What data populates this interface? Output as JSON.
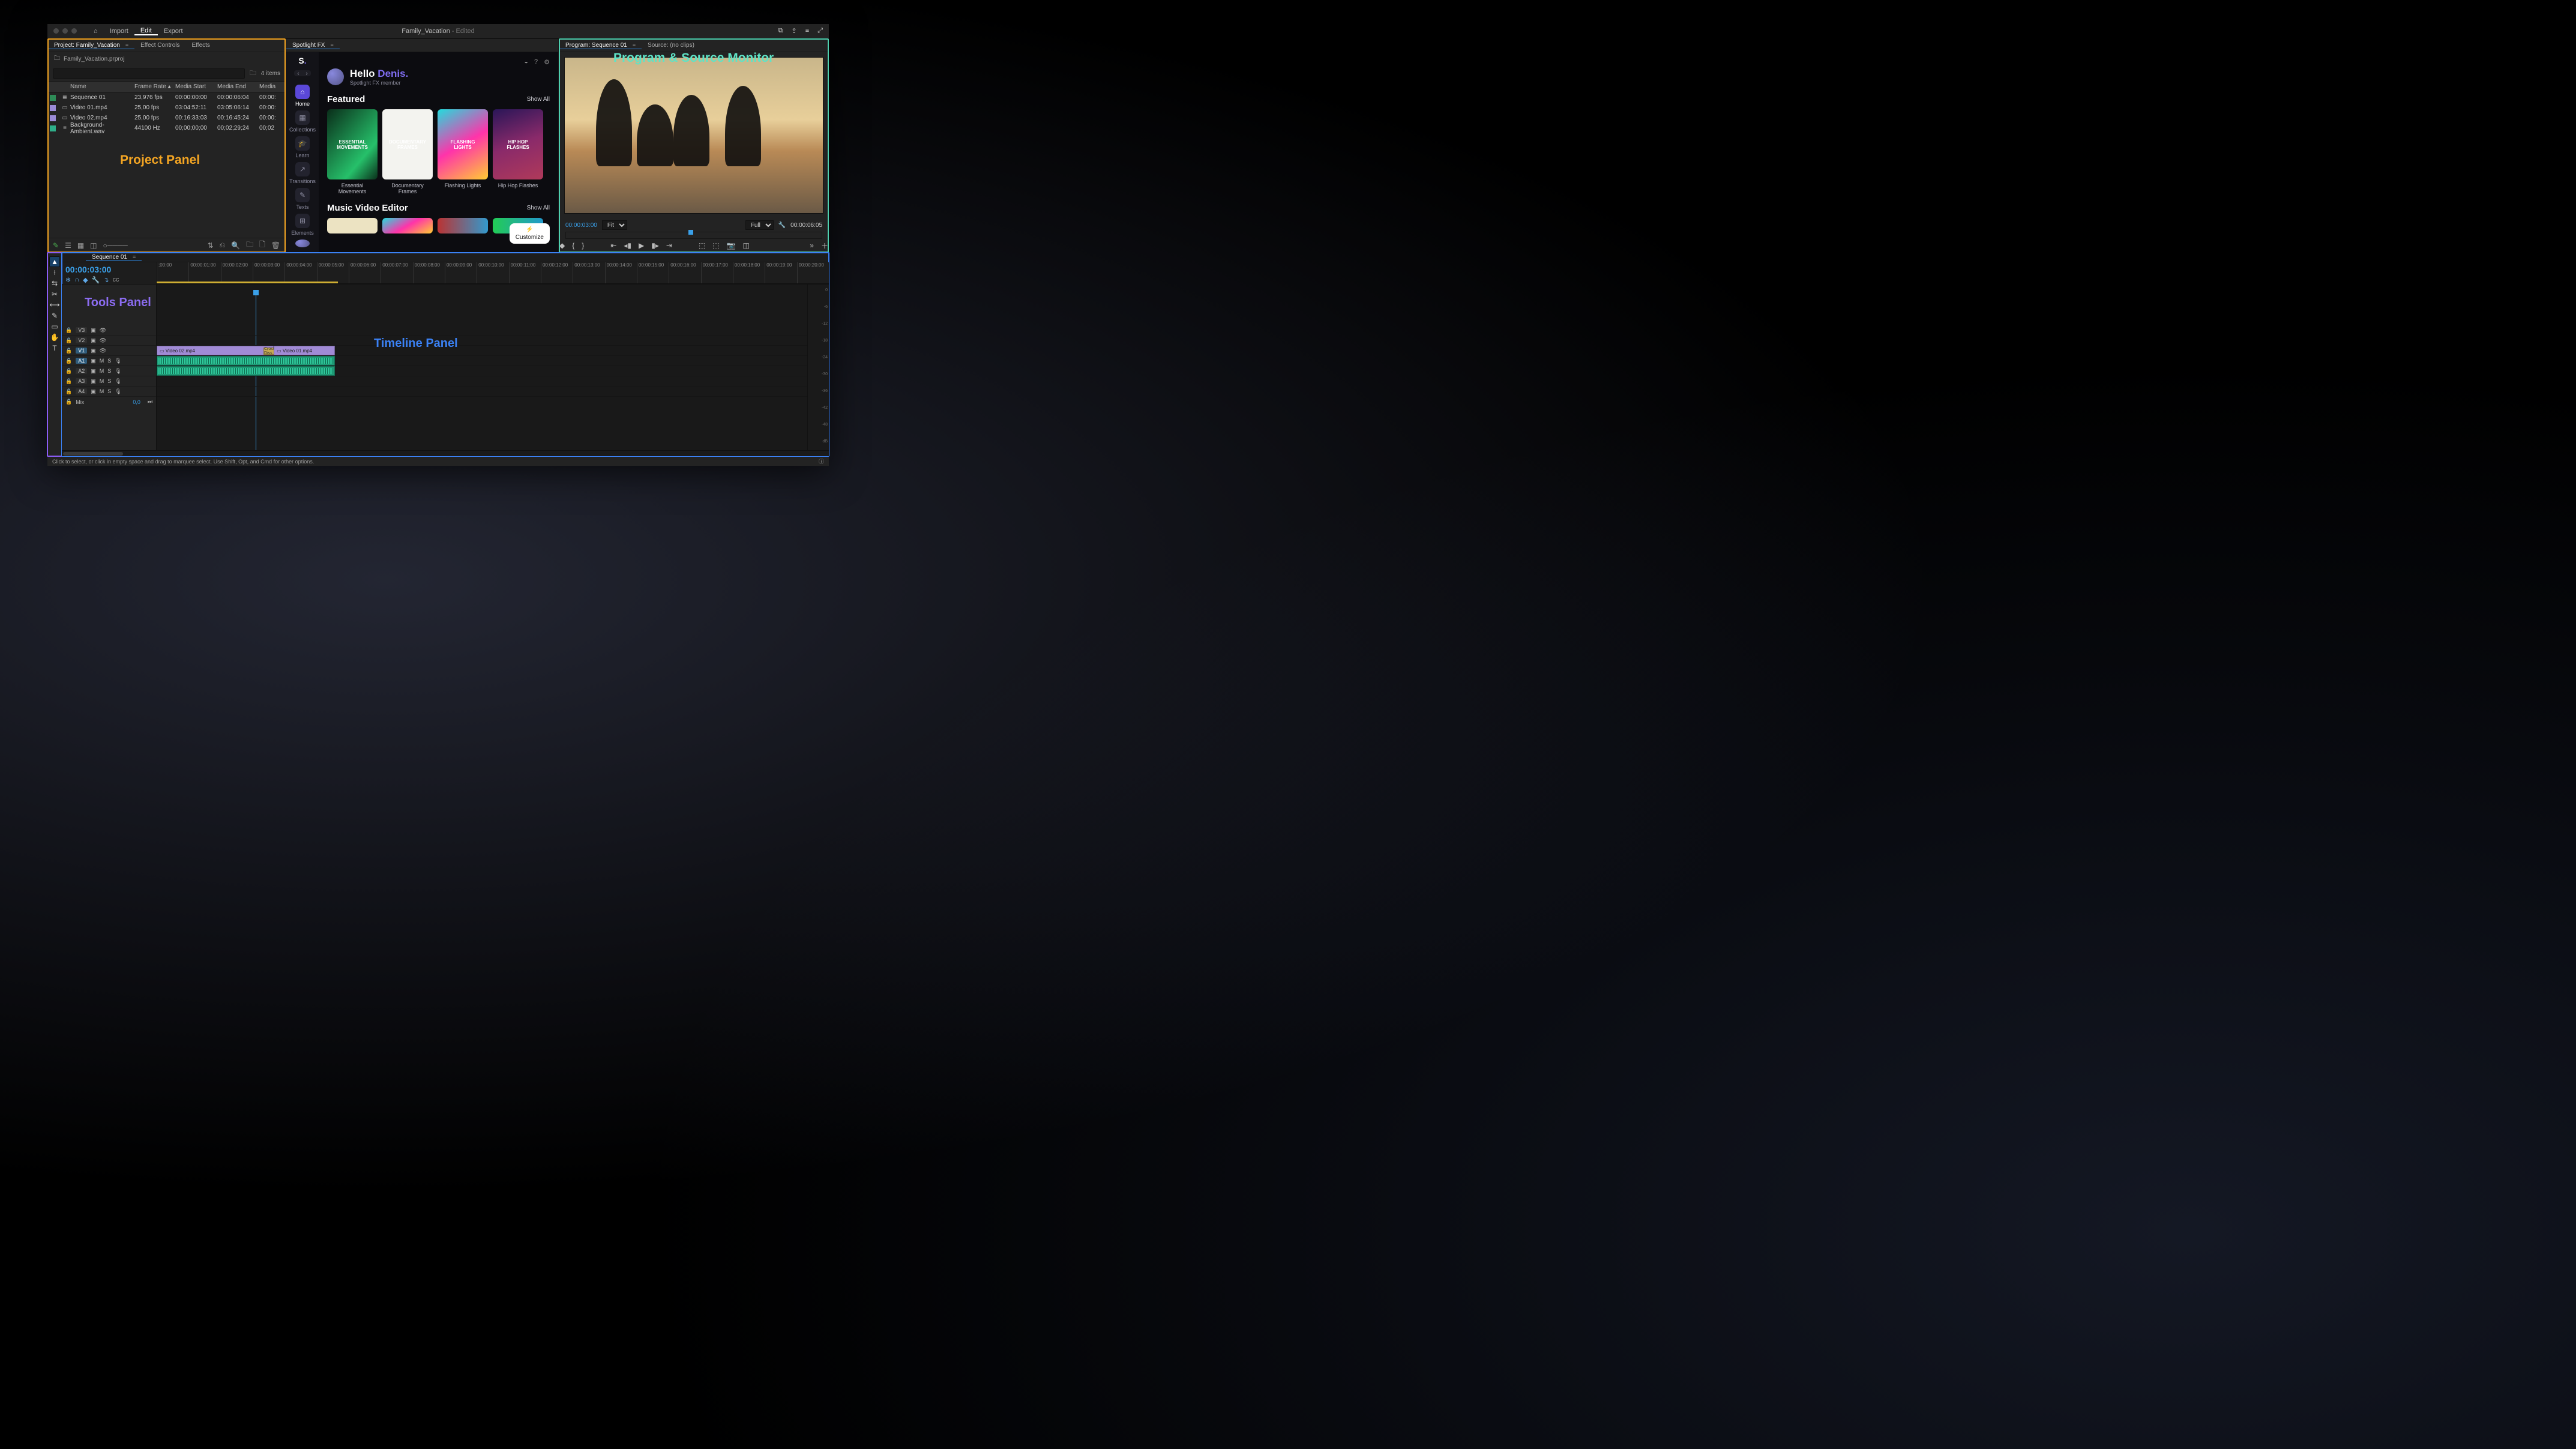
{
  "titlebar": {
    "home_icon": "⌂",
    "import": "Import",
    "edit": "Edit",
    "export": "Export",
    "doc_title": "Family_Vacation",
    "doc_status": " - Edited"
  },
  "project": {
    "tab_project": "Project: Family_Vacation",
    "tab_effect_controls": "Effect Controls",
    "tab_effects": "Effects",
    "crumb": "Family_Vacation.prproj",
    "search_placeholder": "",
    "items_count": "4 items",
    "headers": {
      "name": "Name",
      "framerate": "Frame Rate",
      "mstart": "Media Start",
      "mend": "Media End",
      "mdur": "Media"
    },
    "rows": [
      {
        "chip": "#2e8b57",
        "icon": "≣",
        "name": "Sequence 01",
        "fr": "23,976 fps",
        "ms": "00:00:00:00",
        "me": "00:00:06:04",
        "md": "00:00:"
      },
      {
        "chip": "#9b8bd6",
        "icon": "▭",
        "name": "Video 01.mp4",
        "fr": "25,00 fps",
        "ms": "03:04:52:11",
        "me": "03:05:06:14",
        "md": "00:00:"
      },
      {
        "chip": "#9b8bd6",
        "icon": "▭",
        "name": "Video 02.mp4",
        "fr": "25,00 fps",
        "ms": "00:16:33:03",
        "me": "00:16:45:24",
        "md": "00:00:"
      },
      {
        "chip": "#2fae8a",
        "icon": "≡",
        "name": "Background-Ambient.wav",
        "fr": "44100 Hz",
        "ms": "00;00;00;00",
        "me": "00;02;29;24",
        "md": "00;02"
      }
    ],
    "annotation": "Project Panel"
  },
  "spotlight": {
    "tab": "Spotlight FX",
    "side": [
      {
        "icon": "⌂",
        "label": "Home",
        "active": true
      },
      {
        "icon": "▦",
        "label": "Collections"
      },
      {
        "icon": "🎓",
        "label": "Learn"
      },
      {
        "icon": "↗",
        "label": "Transitions"
      },
      {
        "icon": "✎",
        "label": "Texts"
      },
      {
        "icon": "⊞",
        "label": "Elements"
      }
    ],
    "hello_prefix": "Hello ",
    "hello_name": "Denis.",
    "hello_sub": "Spotlight FX member",
    "featured_title": "Featured",
    "show_all": "Show All",
    "featured": [
      {
        "label": "Essential Movements",
        "thumb": "ESSENTIAL MOVEMENTS"
      },
      {
        "label": "Documentary Frames",
        "thumb": "DOCUMENTARY FRAMES"
      },
      {
        "label": "Flashing Lights",
        "thumb": "FLASHING LIGHTS"
      },
      {
        "label": "Hip Hop Flashes",
        "thumb": "HIP HOP FLASHES"
      }
    ],
    "mve_title": "Music Video Editor",
    "customize": "Customize"
  },
  "program": {
    "tab": "Program: Sequence 01",
    "source": "Source: (no clips)",
    "annotation": "Program & Source Monitor",
    "tc_left": "00:00:03:00",
    "fit": "Fit",
    "full": "Full",
    "tc_right": "00:00:06:05"
  },
  "tools": {
    "annotation": "Tools Panel",
    "items": [
      "▲",
      "⟊",
      "⇆",
      "✂",
      "⟷",
      "✎",
      "▭",
      "✋",
      "T"
    ]
  },
  "timeline": {
    "tab": "Sequence 01",
    "tc": "00:00:03:00",
    "annotation": "Timeline Panel",
    "ruler": [
      ";00:00",
      "00:00:01:00",
      "00:00:02:00",
      "00:00:03:00",
      "00:00:04:00",
      "00:00:05:00",
      "00:00:06:00",
      "00:00:07:00",
      "00:00:08:00",
      "00:00:09:00",
      "00:00:10:00",
      "00:00:11:00",
      "00:00:12:00",
      "00:00:13:00",
      "00:00:14:00",
      "00:00:15:00",
      "00:00:16:00",
      "00:00:17:00",
      "00:00:18:00",
      "00:00:19:00",
      "00:00:20:00"
    ],
    "video_tracks": [
      "V3",
      "V2",
      "V1"
    ],
    "audio_tracks": [
      "A1",
      "A2",
      "A3",
      "A4"
    ],
    "mix": "Mix",
    "mix_db": "0,0",
    "clip_v1": "Video 02.mp4",
    "clip_v2": "Video 01.mp4",
    "cross": "Cross Diss",
    "meter_labels": [
      "0",
      "-6",
      "-12",
      "-18",
      "-24",
      "-30",
      "-36",
      "-42",
      "-48",
      "dB"
    ]
  },
  "status": {
    "text": "Click to select, or click in empty space and drag to marquee select. Use Shift, Opt, and Cmd for other options."
  }
}
